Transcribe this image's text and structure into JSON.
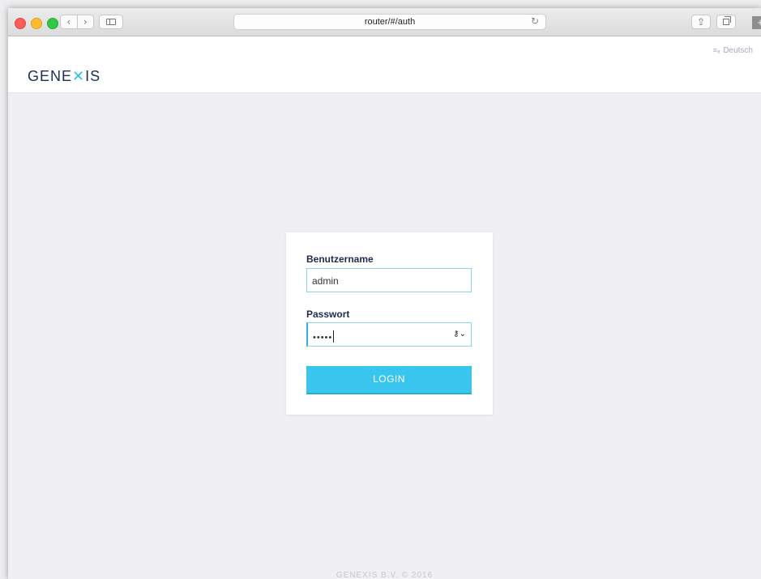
{
  "browser": {
    "url": "router/#/auth",
    "back_glyph": "‹",
    "forward_glyph": "›",
    "reload_glyph": "↻",
    "share_glyph": "⇪",
    "newtab_glyph": "+"
  },
  "header": {
    "language": "Deutsch",
    "language_icon": "≡ₐ",
    "logo_part1": "GENE",
    "logo_x": "✕",
    "logo_part2": "IS"
  },
  "login": {
    "username_label": "Benutzername",
    "username_value": "admin",
    "password_label": "Passwort",
    "password_value": "•••••",
    "password_icon": "🔑",
    "button_label": "LOGIN"
  },
  "footer": {
    "text": "GENEXIS B.V. © 2016"
  },
  "colors": {
    "accent": "#38c6ee",
    "brand": "#1d2d57",
    "background": "#f0f0f2"
  }
}
